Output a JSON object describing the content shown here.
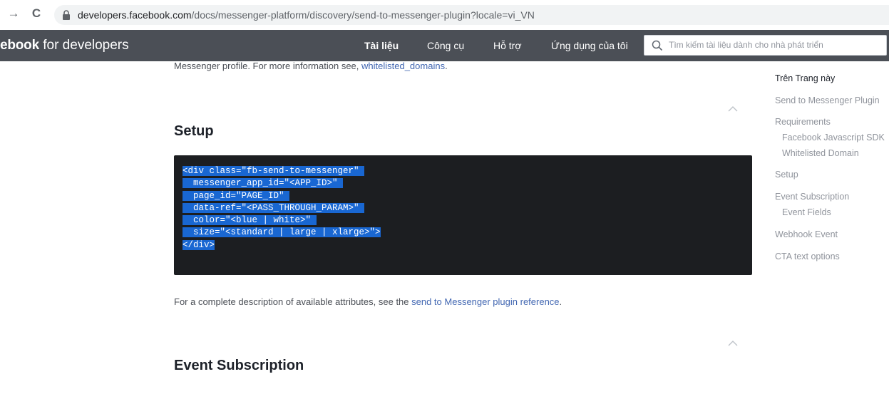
{
  "browser": {
    "url_host": "developers.facebook.com",
    "url_path": "/docs/messenger-platform/discovery/send-to-messenger-plugin?locale=vi_VN",
    "forward_glyph": "→",
    "reload_glyph": "C"
  },
  "header": {
    "brand_bold": "ebook",
    "brand_rest": " for developers",
    "nav": [
      "Tài liệu",
      "Công cụ",
      "Hỗ trợ",
      "Ứng dụng của tôi"
    ],
    "search_placeholder": "Tìm kiếm tài liệu dành cho nhà phát triển",
    "bg_color": "#4b4f56"
  },
  "main": {
    "intro_text": "Messenger profile. For more information see, ",
    "intro_link": "whitelisted_domains",
    "intro_end": ".",
    "setup_heading": "Setup",
    "code_lines": [
      "<div class=\"fb-send-to-messenger\" ",
      "  messenger_app_id=\"<APP_ID>\" ",
      "  page_id=\"PAGE_ID\" ",
      "  data-ref=\"<PASS_THROUGH_PARAM>\" ",
      "  color=\"<blue | white>\" ",
      "  size=\"<standard | large | xlarge>\">",
      "</div>"
    ],
    "attributes_text": "For a complete description of available attributes, see the ",
    "attributes_link": "send to Messenger plugin reference",
    "attributes_end": ".",
    "event_heading": "Event Subscription"
  },
  "toc": {
    "title": "Trên Trang này",
    "items": [
      "Send to Messenger Plugin",
      "Requirements",
      "Facebook Javascript SDK",
      "Whitelisted Domain",
      "Setup",
      "Event Subscription",
      "Event Fields",
      "Webhook Event",
      "CTA text options"
    ]
  }
}
